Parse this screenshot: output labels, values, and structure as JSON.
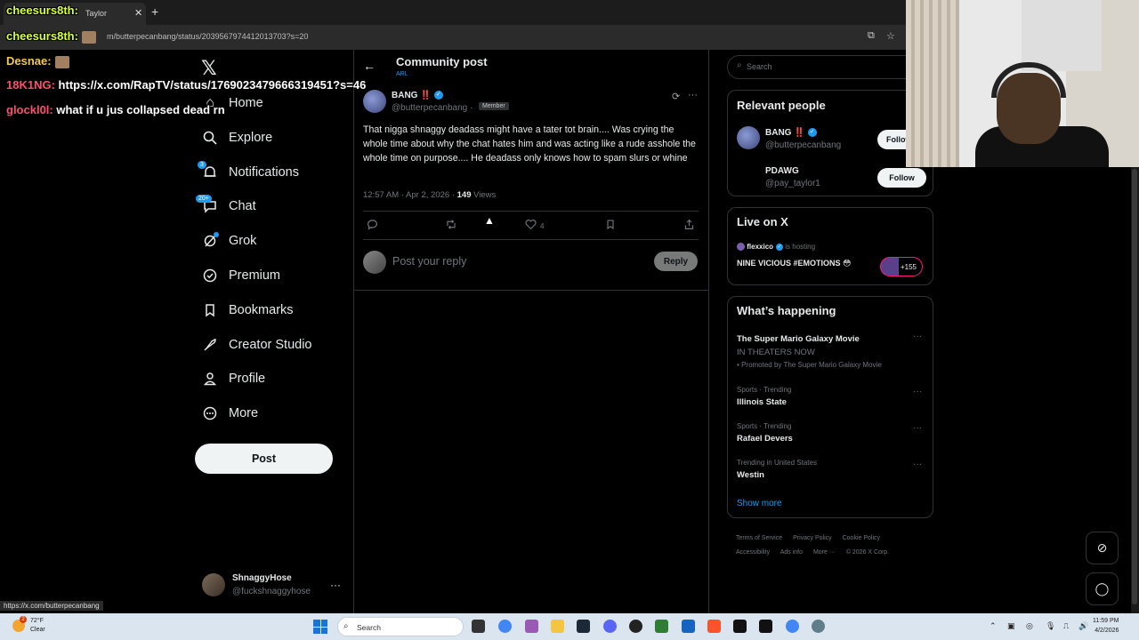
{
  "browser": {
    "tab_title": "Taylor",
    "url": "m/butterpecanbang/status/2039567974412013703?s=20",
    "status_link": "https://x.com/butterpecanbang"
  },
  "stream_chat": [
    {
      "user": "cheesurs8th:",
      "message": ""
    },
    {
      "user": "cheesurs8th:",
      "message": ""
    },
    {
      "user": "Desnae:",
      "message": ""
    },
    {
      "user": "18K1NG:",
      "message": "https://x.com/RapTV/status/1769023479666319451?s=46"
    },
    {
      "user": "glockl0l:",
      "message": "what if u jus collapsed dead rn"
    }
  ],
  "nav": {
    "items": [
      {
        "label": "Home",
        "icon": "home-icon"
      },
      {
        "label": "Explore",
        "icon": "search-icon"
      },
      {
        "label": "Notifications",
        "icon": "bell-icon",
        "badge": "3"
      },
      {
        "label": "Chat",
        "icon": "chat-icon",
        "badge": "20+"
      },
      {
        "label": "Grok",
        "icon": "grok-icon"
      },
      {
        "label": "Premium",
        "icon": "premium-icon"
      },
      {
        "label": "Bookmarks",
        "icon": "bookmark-icon"
      },
      {
        "label": "Creator Studio",
        "icon": "rocket-icon"
      },
      {
        "label": "Profile",
        "icon": "person-icon"
      },
      {
        "label": "More",
        "icon": "more-circle-icon"
      }
    ],
    "post_button": "Post",
    "account": {
      "name": "ShnaggyHose",
      "handle": "@fuckshnaggyhose"
    }
  },
  "header": {
    "title": "Community post",
    "subtitle": "ARL"
  },
  "post": {
    "author": "BANG",
    "author_badge": "‼️",
    "handle": "@butterpecanbang",
    "dot": "·",
    "member_label": "Member",
    "text": "That nigga shnaggy deadass might have a tater tot brain.... Was crying the whole time about why the chat hates him and was acting like a rude asshole the whole time on purpose.... He deadass only knows how to spam slurs or whine",
    "timestamp": "12:57 AM · Apr 2, 2026 · ",
    "views_count": "149",
    "views_label": " Views",
    "likes": "4",
    "reply_placeholder": "Post your reply",
    "reply_button": "Reply"
  },
  "right": {
    "search_placeholder": "Search",
    "relevant_title": "Relevant people",
    "people": [
      {
        "name": "BANG ‼️",
        "handle": "@butterpecanbang",
        "button": "Follow"
      },
      {
        "name": "PDAWG",
        "handle": "@pay_taylor1",
        "button": "Follow"
      }
    ],
    "live_title": "Live on X",
    "live": {
      "host": "flexxico",
      "hosting": " is hosting",
      "title": "NINE VICIOUS #EMOTIONS 😳",
      "count": "+155"
    },
    "happening_title": "What’s happening",
    "trends": [
      {
        "context": "",
        "name": "The Super Mario Galaxy Movie",
        "sub": "IN THEATERS NOW",
        "promo": "Promoted by The Super Mario Galaxy Movie"
      },
      {
        "context": "Sports · Trending",
        "name": "Illinois State"
      },
      {
        "context": "Sports · Trending",
        "name": "Rafael Devers"
      },
      {
        "context": "Trending in United States",
        "name": "Westin"
      }
    ],
    "show_more": "Show more",
    "footer": [
      "Terms of Service",
      "Privacy Policy",
      "Cookie Policy",
      "Accessibility",
      "Ads info",
      "More ···",
      "© 2026 X Corp."
    ]
  },
  "taskbar": {
    "temp": "72°F",
    "condition": "Clear",
    "search": "Search",
    "time": "11:59 PM",
    "date": "4/2/2026",
    "weather_badge": "2"
  },
  "colors": {
    "accent": "#1d9bf0",
    "background": "#000000",
    "border": "#2f3336",
    "chat_user": "#d8ff3a"
  }
}
